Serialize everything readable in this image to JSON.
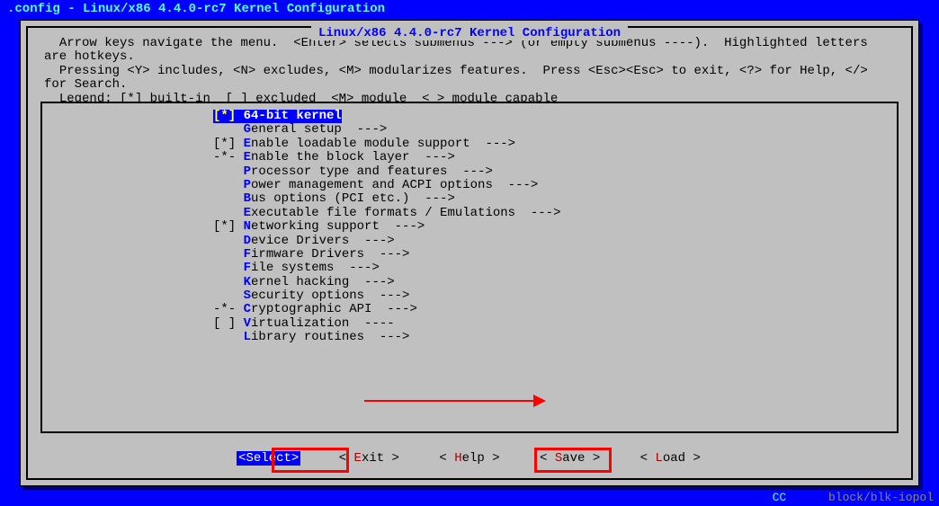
{
  "window_title": ".config - Linux/x86 4.4.0-rc7 Kernel Configuration",
  "dialog_title": " Linux/x86 4.4.0-rc7 Kernel Configuration ",
  "help_lines": "  Arrow keys navigate the menu.  <Enter> selects submenus ---> (or empty submenus ----).  Highlighted letters are hotkeys.\n  Pressing <Y> includes, <N> excludes, <M> modularizes features.  Press <Esc><Esc> to exit, <?> for Help, </> for Search.\n  Legend: [*] built-in  [ ] excluded  <M> module  < > module capable",
  "menu": [
    {
      "mark": "[*]",
      "hot": "6",
      "rest": "4-bit kernel",
      "selected": true,
      "arrow": ""
    },
    {
      "mark": "   ",
      "hot": "G",
      "rest": "eneral setup  --->",
      "arrow": ""
    },
    {
      "mark": "[*]",
      "hot": "E",
      "rest": "nable loadable module support  --->",
      "arrow": ""
    },
    {
      "mark": "-*-",
      "hot": "E",
      "rest": "nable the block layer  --->",
      "arrow": ""
    },
    {
      "mark": "   ",
      "hot": "P",
      "rest": "rocessor type and features  --->",
      "arrow": ""
    },
    {
      "mark": "   ",
      "hot": "P",
      "rest": "ower management and ACPI options  --->",
      "arrow": ""
    },
    {
      "mark": "   ",
      "hot": "B",
      "rest": "us options (PCI etc.)  --->",
      "arrow": ""
    },
    {
      "mark": "   ",
      "hot": "E",
      "rest": "xecutable file formats / Emulations  --->",
      "arrow": ""
    },
    {
      "mark": "[*]",
      "hot": "N",
      "rest": "etworking support  --->",
      "arrow": ""
    },
    {
      "mark": "   ",
      "hot": "D",
      "rest": "evice Drivers  --->",
      "arrow": ""
    },
    {
      "mark": "   ",
      "hot": "F",
      "rest": "irmware Drivers  --->",
      "arrow": ""
    },
    {
      "mark": "   ",
      "hot": "F",
      "rest": "ile systems  --->",
      "arrow": ""
    },
    {
      "mark": "   ",
      "hot": "K",
      "rest": "ernel hacking  --->",
      "arrow": ""
    },
    {
      "mark": "   ",
      "hot": "S",
      "rest": "ecurity options  --->",
      "arrow": ""
    },
    {
      "mark": "-*-",
      "hot": "C",
      "rest": "ryptographic API  --->",
      "arrow": ""
    },
    {
      "mark": "[ ]",
      "hot": "V",
      "rest": "irtualization  ----",
      "arrow": ""
    },
    {
      "mark": "   ",
      "hot": "L",
      "rest": "ibrary routines  --->",
      "arrow": ""
    }
  ],
  "buttons": {
    "select": {
      "pre": "<",
      "hk": "S",
      "rest": "elect>",
      "active": true
    },
    "exit": {
      "pre": "< ",
      "hk": "E",
      "rest": "xit >"
    },
    "help": {
      "pre": "< ",
      "hk": "H",
      "rest": "elp >"
    },
    "save": {
      "pre": "< ",
      "hk": "S",
      "rest": "ave >"
    },
    "load": {
      "pre": "< ",
      "hk": "L",
      "rest": "oad >"
    }
  },
  "bg_bottom_cc": "CC",
  "bg_bottom_rest": "      block/blk-iopol"
}
